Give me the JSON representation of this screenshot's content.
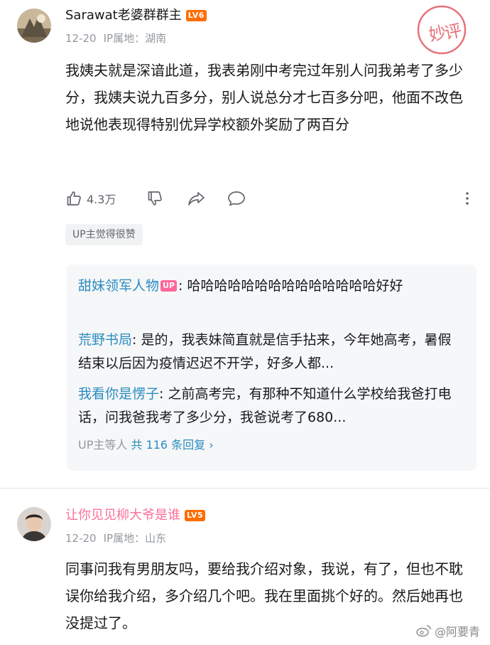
{
  "comments": [
    {
      "username": "Sarawat老婆群群主",
      "level": "LV6",
      "level_color": "#ff6c00",
      "date": "12-20",
      "ip": "IP属地：湖南",
      "text": "我姨夫就是深谙此道，我表弟刚中考完过年别人问我弟考了多少分，我姨夫说九百多分，别人说总分才七百多分吧，他面不改色地说他表现得特别优异学校额外奖励了两百分",
      "likes": "4.3万",
      "tag": "UP主觉得很赞",
      "replies": [
        {
          "name": "甜妹领军人物",
          "badge": "UP",
          "content": ": 哈哈哈哈哈哈哈哈哈哈哈哈哈哈好好"
        },
        {
          "name": "荒野书局",
          "content": ": 是的，我表妹简直就是信手拈来，今年她高考，暑假结束以后因为疫情迟迟不开学，好多人都..."
        },
        {
          "name": "我看你是愣子",
          "content": ": 之前高考完，有那种不知道什么学校给我爸打电话，问我爸我考了多少分，我爸说考了680..."
        }
      ],
      "reply_summary_prefix": "UP主等人",
      "reply_summary_count": "共 116 条回复",
      "reply_summary_arrow": "›"
    },
    {
      "username": "让你见见柳大爷是谁",
      "level": "LV5",
      "level_color": "#ff6c00",
      "name_color": "#fb7299",
      "date": "12-20",
      "ip": "IP属地：山东",
      "text": "同事问我有男朋友吗，要给我介绍对象，我说，有了，但也不耽误你给我介绍，多介绍几个吧。我在里面挑个好的。然后她再也没提过了。"
    }
  ],
  "stamp": {
    "text_1": "妙",
    "text_2": "评",
    "color": "#e8727a"
  },
  "watermark": "@阿要青",
  "icons": [
    "like-icon",
    "dislike-icon",
    "share-icon",
    "comment-icon",
    "more-icon",
    "weibo-icon"
  ]
}
